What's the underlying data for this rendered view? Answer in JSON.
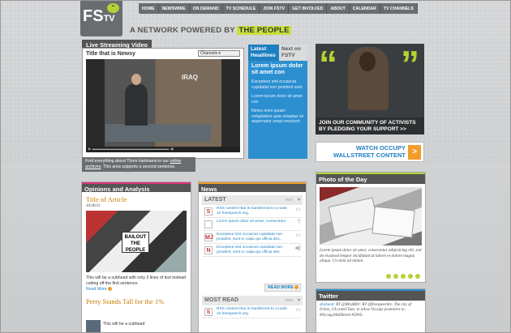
{
  "brand": {
    "logo": "FS",
    "logo_tv": "TV",
    "tagline": "A NETWORK POWERED BY",
    "tagline_highlight": "THE PEOPLE"
  },
  "nav": [
    "HOME",
    "NEWSWIRE",
    "ON DEMAND",
    "TV SCHEDULE",
    "JOIN FSTV",
    "GET INVOLVED",
    "ABOUT",
    "CALENDAR",
    "TV CHANNELS"
  ],
  "video": {
    "section_title": "Live Streaming Video",
    "title": "Title that is Newsy",
    "channels_select": "Channels",
    "screen_text": "IRAQ",
    "note_prefix": "Find everything about Thom Hartmann in our ",
    "note_link": "online archives",
    "note_suffix": ". This area supports a second sentence."
  },
  "headlines": {
    "tab_latest": "Latest Headlines",
    "tab_next": "Next on FSTV",
    "lead": "Lorem ipsum dolor sit amet con",
    "items": [
      "Excepteur sint occaecat cupidatat non proident sunt",
      "Lorem ipsum dolor sit amet con",
      "Nemo enim ipsam voluptatem quia voluptas sit aspernatur sequi nesciunt"
    ]
  },
  "promo": {
    "text": "JOIN OUR COMMUNITY OF ACTIVISTS BY PLEDGING YOUR SUPPORT >>"
  },
  "occupy": {
    "text": "WATCH OCCUPY WALLSTREET CONTENT",
    "arrow": ">"
  },
  "opinions": {
    "title": "Opinions and Analysis",
    "article_title": "Title of Article",
    "date": "10/30/11",
    "sign": "BAILOUT THE PEOPLE",
    "subhead": "This will be a subhead with only 3 lines of text instead cutting off the first sentence.",
    "read_more": "Read More",
    "article2_title": "Perry Stands Tall for the 1%",
    "article2_text": "This will be a subhead"
  },
  "news": {
    "title": "News",
    "latest": "LATEST",
    "rss": "RSS",
    "latest_items": [
      {
        "icon": "S",
        "text": "RSS content that is transferred to a node on freespeech.org."
      },
      {
        "icon": "",
        "text": "Lorem ipsum dolor sit amet, consectetur"
      },
      {
        "icon": "MJ",
        "text": "Excepteur sint occaecat cupidatat non proident, sunt in culpa qui officia des."
      },
      {
        "icon": "N",
        "text": "Excepteur sint occaecat cupidatat non proident, sunt in culpa qui officia des."
      }
    ],
    "read_more": "READ MORE",
    "most_read": "MOST READ",
    "most_read_items": [
      {
        "icon": "S",
        "text": "RSS content that is transferred to a node on freespeech.org."
      }
    ]
  },
  "photo_of_day": {
    "title": "Photo of the Day",
    "caption": "Lorem ipsum dolor sit amet, consectetur adipisicing elit, sed do eiusmod tempor incididunt ut labore et dolore magna aliqua. Ut enim ad minim."
  },
  "twitter": {
    "title": "Twitter",
    "user": "dtsiband:",
    "tweet": " RT @MrsMDr: RT @freespeechtv: The city of Irvine, CA voted Tues. to allow Occupy protesters to. #OccupyWallStreet #OWS."
  }
}
